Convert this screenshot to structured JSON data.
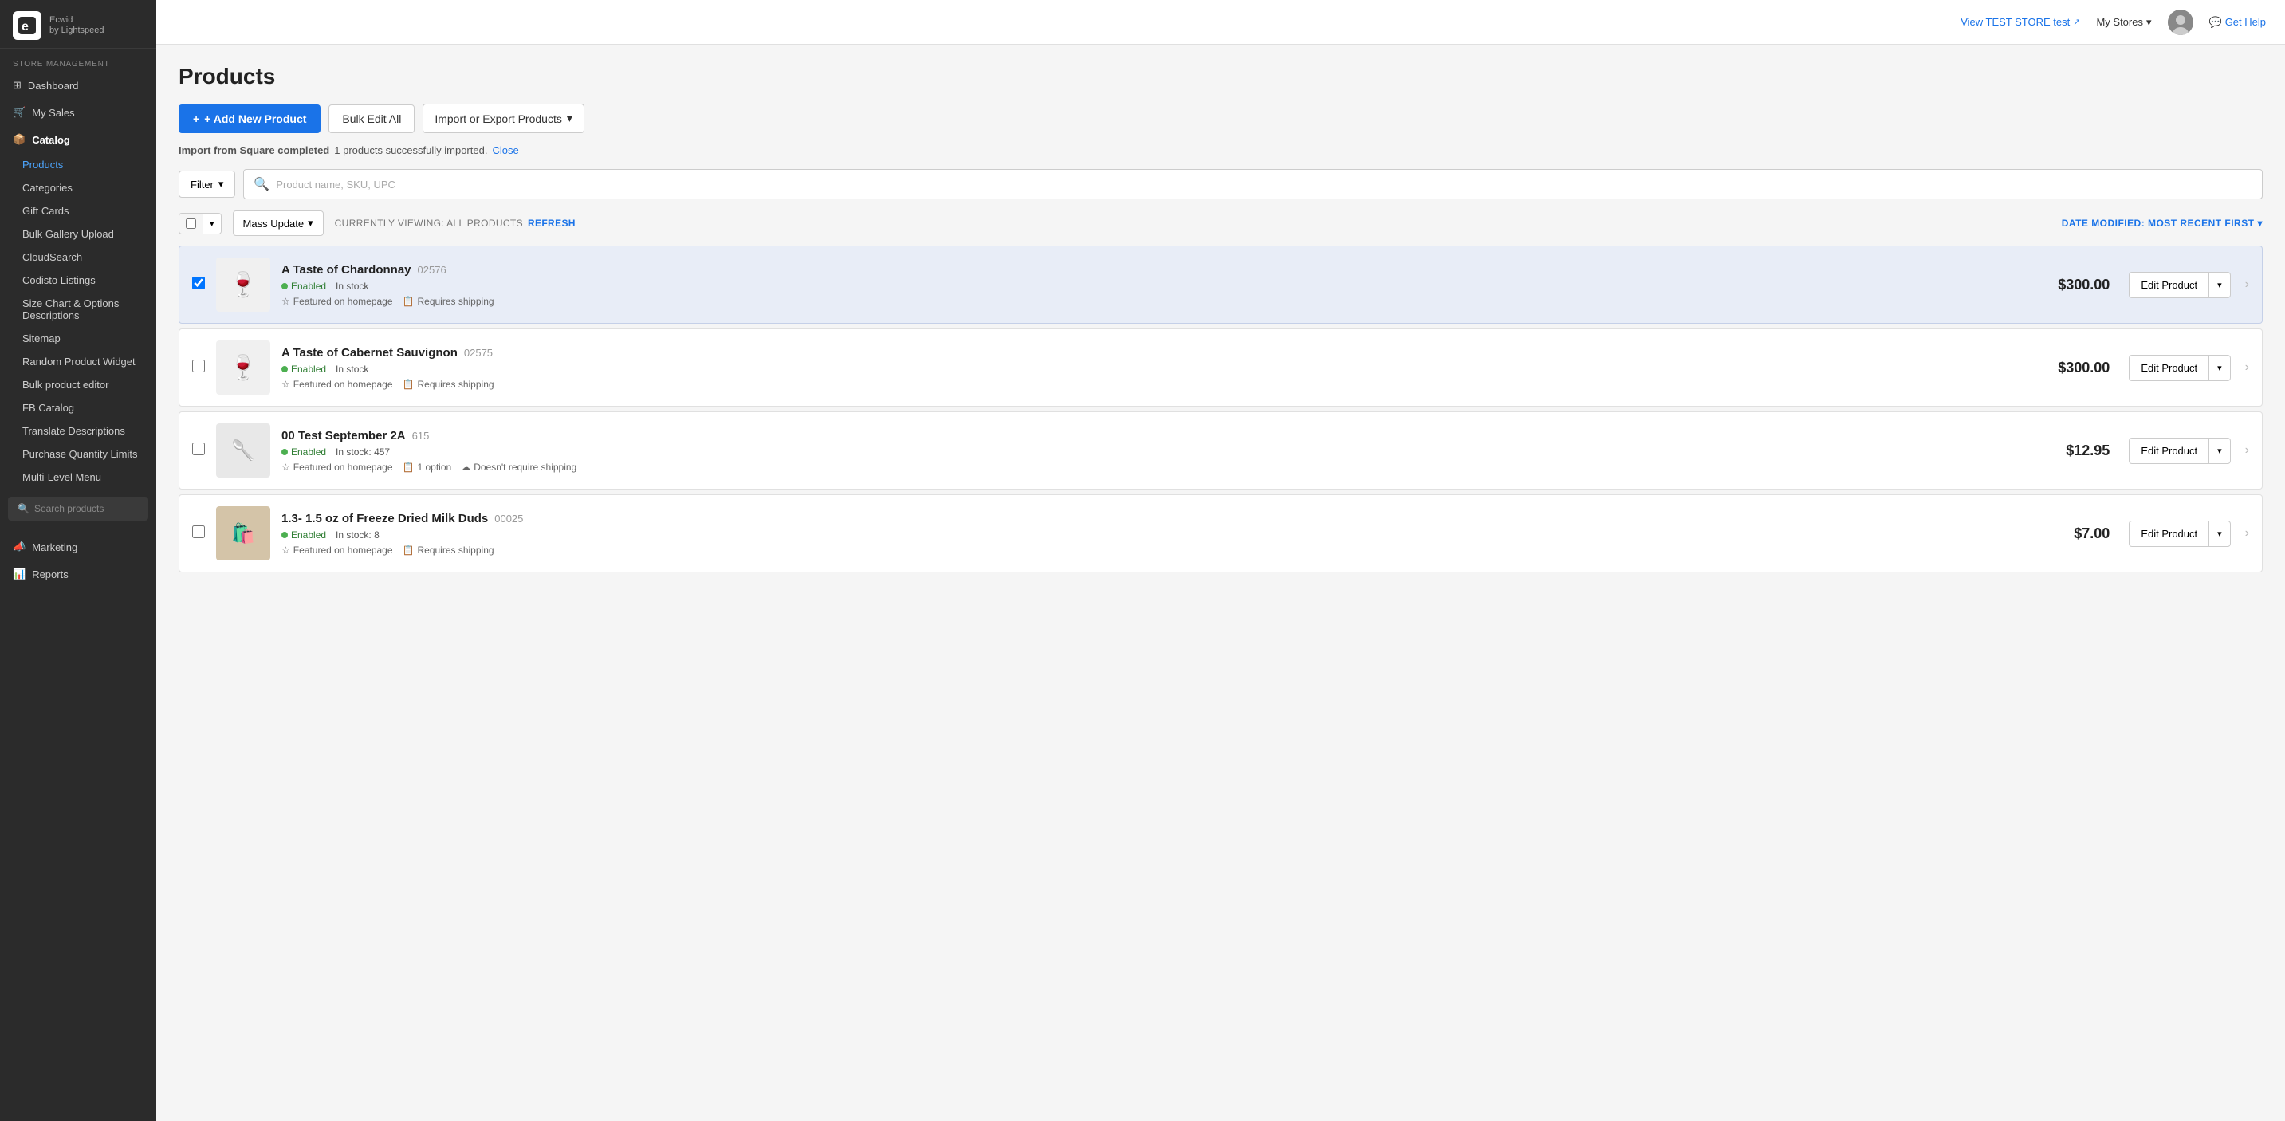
{
  "logo": {
    "icon": "E",
    "brand": "Ecwid",
    "sub": "by Lightspeed"
  },
  "topbar": {
    "view_store_label": "View TEST STORE test",
    "my_stores_label": "My Stores",
    "get_help_label": "Get Help"
  },
  "sidebar": {
    "section_store": "Store management",
    "dashboard": "Dashboard",
    "my_sales": "My Sales",
    "catalog_label": "Catalog",
    "catalog_items": [
      {
        "id": "products",
        "label": "Products",
        "active": true
      },
      {
        "id": "categories",
        "label": "Categories"
      },
      {
        "id": "gift-cards",
        "label": "Gift Cards"
      },
      {
        "id": "bulk-gallery",
        "label": "Bulk Gallery Upload"
      },
      {
        "id": "cloudsearch",
        "label": "CloudSearch"
      },
      {
        "id": "codisto",
        "label": "Codisto Listings"
      },
      {
        "id": "size-chart",
        "label": "Size Chart & Options Descriptions"
      },
      {
        "id": "sitemap",
        "label": "Sitemap"
      },
      {
        "id": "random-widget",
        "label": "Random Product Widget"
      },
      {
        "id": "bulk-editor",
        "label": "Bulk product editor"
      },
      {
        "id": "fb-catalog",
        "label": "FB Catalog"
      },
      {
        "id": "translate",
        "label": "Translate Descriptions"
      },
      {
        "id": "purchase-limits",
        "label": "Purchase Quantity Limits"
      },
      {
        "id": "multi-menu",
        "label": "Multi-Level Menu"
      }
    ],
    "search_placeholder": "Search products",
    "marketing_label": "Marketing",
    "reports_label": "Reports"
  },
  "page": {
    "title": "Products",
    "add_product_label": "+ Add New Product",
    "bulk_edit_label": "Bulk Edit All",
    "import_export_label": "Import or Export Products",
    "import_notice": "Import from Square completed",
    "import_success": "1 products successfully imported.",
    "close_label": "Close",
    "filter_label": "Filter",
    "search_placeholder": "Product name, SKU, UPC",
    "mass_update_label": "Mass Update",
    "viewing_label": "CURRENTLY VIEWING: ALL PRODUCTS",
    "refresh_label": "REFRESH",
    "sort_label": "DATE MODIFIED: MOST RECENT FIRST"
  },
  "products": [
    {
      "id": 1,
      "name": "A Taste of Chardonnay",
      "sku": "02576",
      "status": "Enabled",
      "stock": "In stock",
      "tags": [
        "Featured on homepage",
        "Requires shipping"
      ],
      "price": "$300.00",
      "img_type": "bottles",
      "highlighted": true
    },
    {
      "id": 2,
      "name": "A Taste of Cabernet Sauvignon",
      "sku": "02575",
      "status": "Enabled",
      "stock": "In stock",
      "tags": [
        "Featured on homepage",
        "Requires shipping"
      ],
      "price": "$300.00",
      "img_type": "bottles",
      "highlighted": false
    },
    {
      "id": 3,
      "name": "00 Test September 2A",
      "sku": "615",
      "status": "Enabled",
      "stock": "In stock: 457",
      "tags": [
        "Featured on homepage",
        "1 option",
        "Doesn't require shipping"
      ],
      "price": "$12.95",
      "img_type": "spoon",
      "highlighted": false
    },
    {
      "id": 4,
      "name": "1.3- 1.5 oz of Freeze Dried Milk Duds",
      "sku": "00025",
      "status": "Enabled",
      "stock": "In stock: 8",
      "tags": [
        "Featured on homepage",
        "Requires shipping"
      ],
      "price": "$7.00",
      "img_type": "bag",
      "highlighted": false
    }
  ]
}
